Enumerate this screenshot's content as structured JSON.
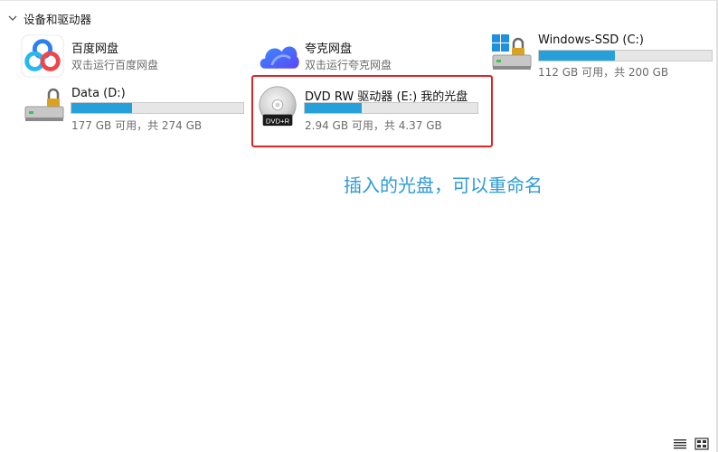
{
  "section": {
    "title": "设备和驱动器"
  },
  "items": [
    {
      "name": "百度网盘",
      "subtitle": "双击运行百度网盘",
      "icon": "baidu-netdisk-icon"
    },
    {
      "name": "夸克网盘",
      "subtitle": "双击运行夸克网盘",
      "icon": "quark-netdisk-icon"
    },
    {
      "name": "Windows-SSD (C:)",
      "space": "112 GB 可用，共 200 GB",
      "used_fraction": 0.44,
      "icon": "windows-drive-icon"
    },
    {
      "name": "Data (D:)",
      "space": "177 GB 可用，共 274 GB",
      "used_fraction": 0.35,
      "icon": "hard-drive-icon"
    },
    {
      "name": "DVD RW 驱动器 (E:) 我的光盘",
      "space": "2.94 GB 可用，共 4.37 GB",
      "used_fraction": 0.33,
      "icon": "dvd-disc-icon",
      "disc_label": "DVD+R"
    }
  ],
  "annotation": "插入的光盘，可以重命名",
  "colors": {
    "accent": "#26a0da",
    "highlight": "#e02424",
    "annotation": "#2e9bd6"
  }
}
